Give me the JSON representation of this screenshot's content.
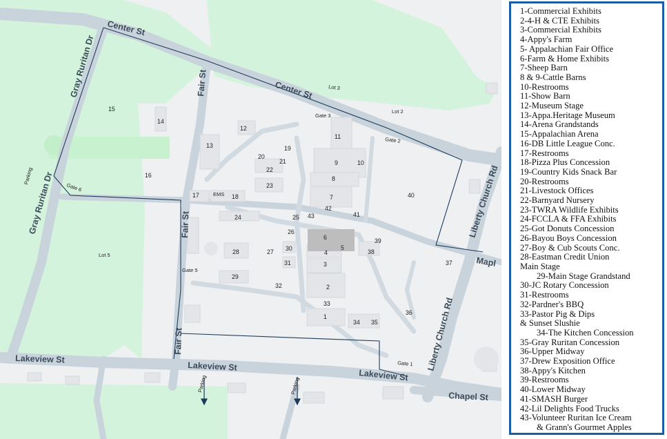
{
  "map": {
    "streets": {
      "center_st_1": "Center St",
      "center_st_2": "Center St",
      "gray_ruritan_dr_1": "Gray Ruritan Dr",
      "gray_ruritan_dr_2": "Gray Ruritan Dr",
      "fair_st_1": "Fair St",
      "fair_st_2": "Fair St",
      "fair_st_3": "Fair St",
      "lakeview_st_1": "Lakeview St",
      "lakeview_st_2": "Lakeview St",
      "lakeview_st_3": "Lakeview St",
      "liberty_church_rd_1": "Liberty Church Rd",
      "liberty_church_rd_2": "Liberty Church Rd",
      "maple": "Mapl",
      "chapel_st": "Chapel St"
    },
    "gates": {
      "gate1": "Gate 1",
      "gate2": "Gate 2",
      "gate3": "Gate 3",
      "gate5": "Gate 5",
      "gate6": "Gate 6"
    },
    "lots": {
      "lot2": "Lot 2",
      "lot3": "Lot 3",
      "lot5": "Lot 5"
    },
    "parking": {
      "p1": "Parking",
      "p2": "Parking",
      "p3": "Parking"
    },
    "ems": "EMS",
    "numbers": {
      "n1": "1",
      "n2": "2",
      "n3": "3",
      "n4": "4",
      "n5": "5",
      "n6": "6",
      "n7": "7",
      "n8": "8",
      "n9": "9",
      "n10": "10",
      "n11": "11",
      "n12": "12",
      "n13": "13",
      "n14": "14",
      "n15": "15",
      "n16": "16",
      "n17": "17",
      "n18": "18",
      "n19": "19",
      "n20": "20",
      "n21": "21",
      "n22": "22",
      "n23": "23",
      "n24": "24",
      "n25": "25",
      "n26": "26",
      "n27": "27",
      "n28": "28",
      "n29": "29",
      "n30": "30",
      "n31": "31",
      "n32": "32",
      "n33": "33",
      "n34": "34",
      "n35": "35",
      "n36": "36",
      "n37": "37",
      "n38": "38",
      "n39": "39",
      "n40": "40",
      "n41": "41",
      "n42": "42",
      "n43": "43"
    },
    "colors": {
      "land": "#eef0f2",
      "green": "#d3f3dc",
      "road": "#c9d3dc",
      "building": "#e3e5e8",
      "boundary": "#1e3a5a",
      "highlight": "#bdbdbd"
    }
  },
  "legend": {
    "items": [
      "1-Commercial Exhibits",
      "2-4-H & CTE Exhibits",
      "3-Commercial Exhibits",
      "4-Appy's Farm",
      "5- Appalachian Fair Office",
      "6-Farm & Home Exhibits",
      "7-Sheep Barn",
      "8 & 9-Cattle Barns",
      "10-Restrooms",
      "11-Show Barn",
      "12-Museum Stage",
      "13-Appa.Heritage Museum",
      "14-Arena Grandstands",
      "15-Appalachian Arena",
      "16-DB Little League Conc.",
      "17-Restrooms",
      "18-Pizza Plus Concession",
      "19-Country Kids Snack Bar",
      "20-Restrooms",
      "21-Livestock Offices",
      "22-Barnyard Nursery",
      "23-TWRA Wildlife Exhibits",
      "24-FCCLA & FFA Exhibits",
      "25-Got Donuts Concession",
      "26-Bayou Boys Concession",
      "27-Boy & Cub Scouts Conc.",
      "28-Eastman Credit Union",
      "Main Stage",
      "29-Main Stage Grandstand",
      "30-JC Rotary Concession",
      "31-Restrooms",
      "32-Pardner's BBQ",
      "33-Pastor Pig & Dips",
      "& Sunset Slushie",
      "34-The Kitchen Concession",
      "35-Gray Ruritan Concession",
      "36-Upper Midway",
      "37-Drew Exposition Office",
      "38-Appy's Kitchen",
      "39-Restrooms",
      "40-Lower Midway",
      "41-SMASH Burger",
      "42-Lil Delights Food Trucks",
      "43-Volunteer Ruritan Ice Cream",
      "& Grann's Gourmet Apples"
    ]
  }
}
